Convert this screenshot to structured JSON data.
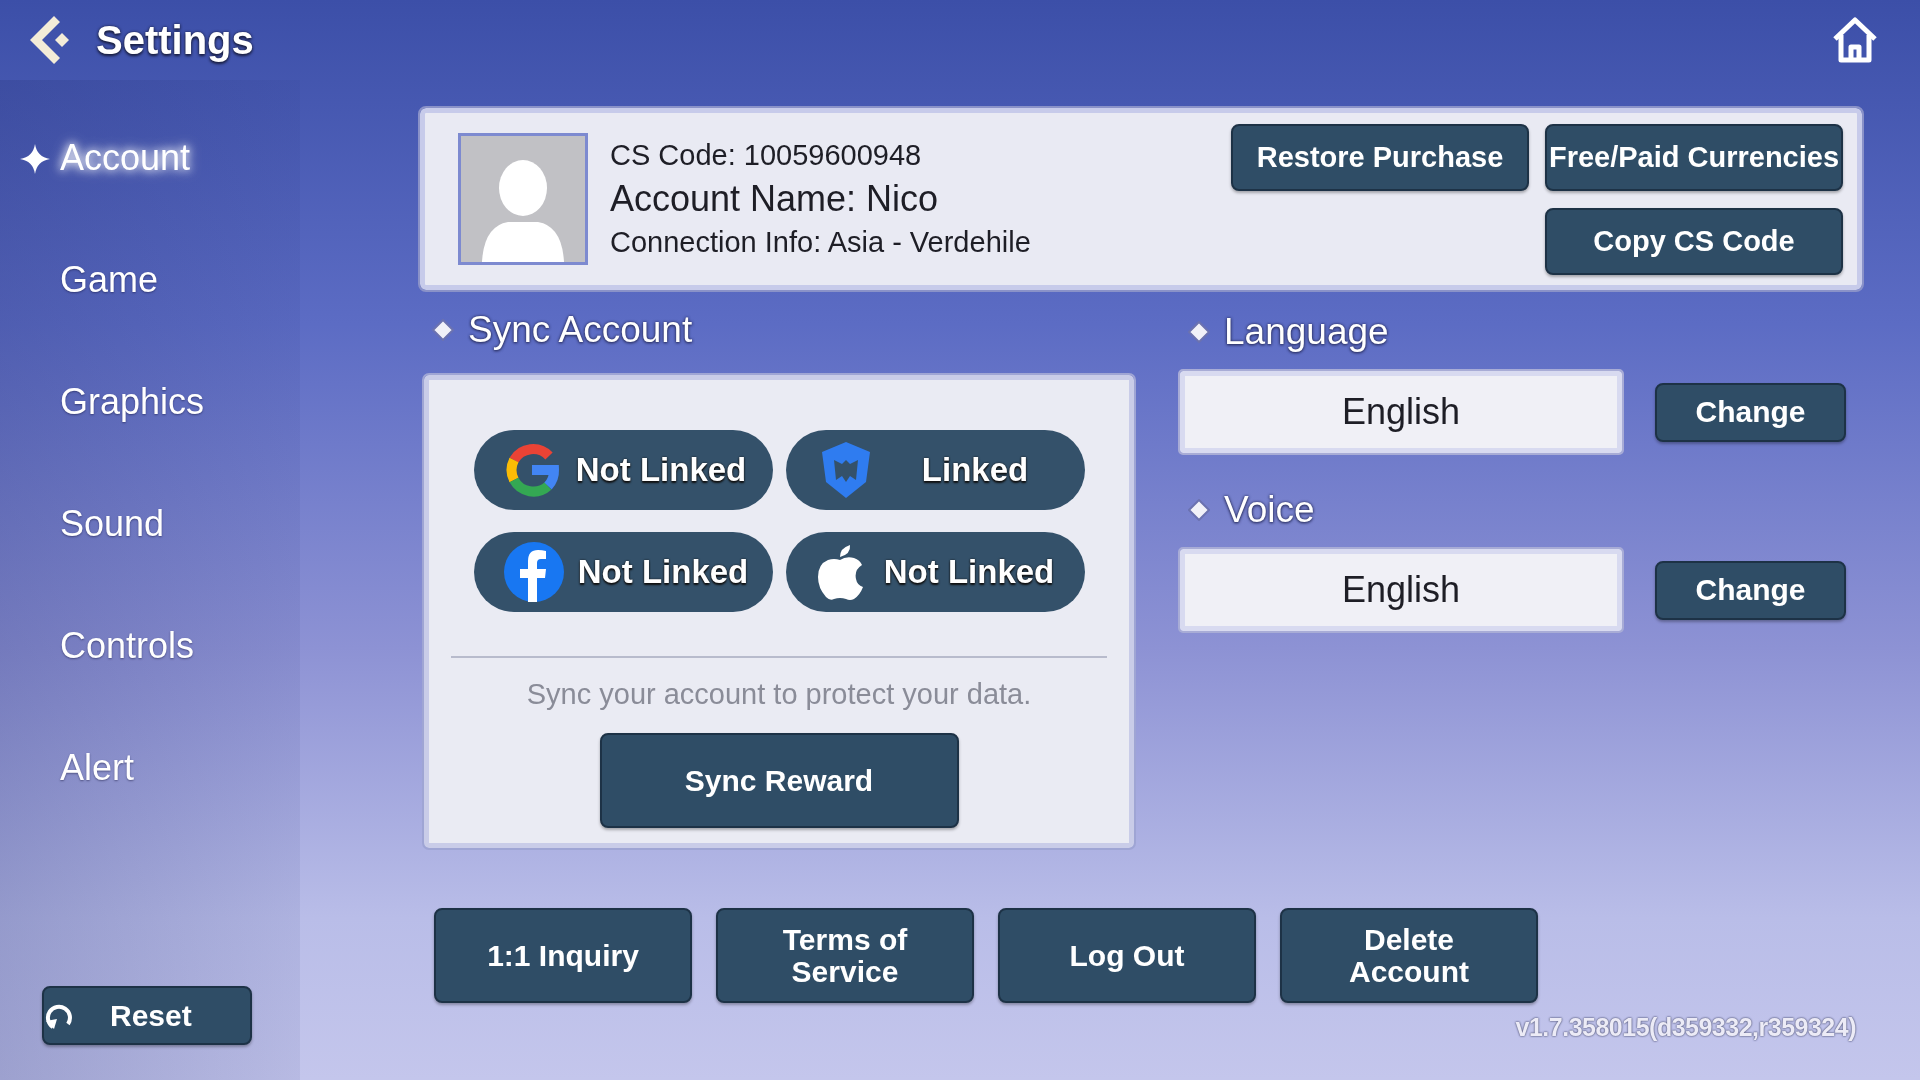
{
  "header": {
    "title": "Settings"
  },
  "sidebar": {
    "items": [
      {
        "label": "Account",
        "selected": true
      },
      {
        "label": "Game",
        "selected": false
      },
      {
        "label": "Graphics",
        "selected": false
      },
      {
        "label": "Sound",
        "selected": false
      },
      {
        "label": "Controls",
        "selected": false
      },
      {
        "label": "Alert",
        "selected": false
      }
    ],
    "reset_button": "Reset"
  },
  "account": {
    "cs_code": "CS Code: 10059600948",
    "account_name": "Account Name: Nico",
    "connection_info": "Connection Info: Asia - Verdehile",
    "buttons": [
      "Restore Purchase",
      "Free/Paid Currencies",
      "Copy CS Code"
    ]
  },
  "sync_account": {
    "title": "Sync Account",
    "links": [
      {
        "kind": "google",
        "label": "Not Linked"
      },
      {
        "kind": "shield",
        "label": "Linked"
      },
      {
        "kind": "facebook",
        "label": "Not Linked"
      },
      {
        "kind": "apple",
        "label": "Not Linked"
      }
    ],
    "note": "Sync your account to protect your data.",
    "button": "Sync Reward"
  },
  "options": [
    {
      "title": "Language",
      "value": "English",
      "button": "Change"
    },
    {
      "title": "Voice",
      "value": "English",
      "button": "Change"
    }
  ],
  "footer_buttons": [
    "1:1 Inquiry",
    "Terms of Service",
    "Log Out",
    "Delete Account"
  ],
  "version": "v1.7.358015(d359332,r359324)"
}
